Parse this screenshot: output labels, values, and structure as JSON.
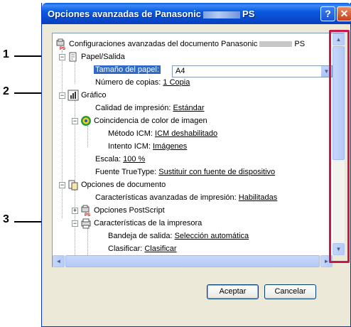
{
  "window": {
    "title_prefix": "Opciones avanzadas de Panasonic",
    "title_suffix": "PS",
    "help_label": "?",
    "close_label": "✕"
  },
  "callouts": [
    "1",
    "2",
    "3"
  ],
  "tree": {
    "root_prefix": "Configuraciones avanzadas del documento Panasonic",
    "root_suffix": "PS",
    "paper_output": "Papel/Salida",
    "paper_size_label": "Tamaño del papel:",
    "paper_size_value": "A4",
    "copies_label": "Número de copias:",
    "copies_value": "1 Copia",
    "graphic": "Gráfico",
    "print_quality_label": "Calidad de impresión:",
    "print_quality_value": "Estándar",
    "icm_label": "Coincidencia de color de imagen",
    "icm_method_label": "Método ICM:",
    "icm_method_value": "ICM deshabilitado",
    "icm_intent_label": "Intento ICM:",
    "icm_intent_value": "Imágenes",
    "scale_label": "Escala:",
    "scale_value": "100 %",
    "truetype_label": "Fuente TrueType:",
    "truetype_value": "Sustituir con fuente de dispositivo",
    "doc_options": "Opciones de documento",
    "adv_features_label": "Características avanzadas de impresión:",
    "adv_features_value": "Habilitadas",
    "postscript": "Opciones PostScript",
    "printer_features": "Características de la impresora",
    "output_tray_label": "Bandeja de salida:",
    "output_tray_value": "Selección automática",
    "sort_label": "Clasificar:",
    "sort_value": "Clasificar"
  },
  "buttons": {
    "ok": "Aceptar",
    "cancel": "Cancelar"
  },
  "colors": {
    "titlebar": "#0a5adf",
    "selection": "#316ac5",
    "callout_highlight": "#c8174b"
  }
}
